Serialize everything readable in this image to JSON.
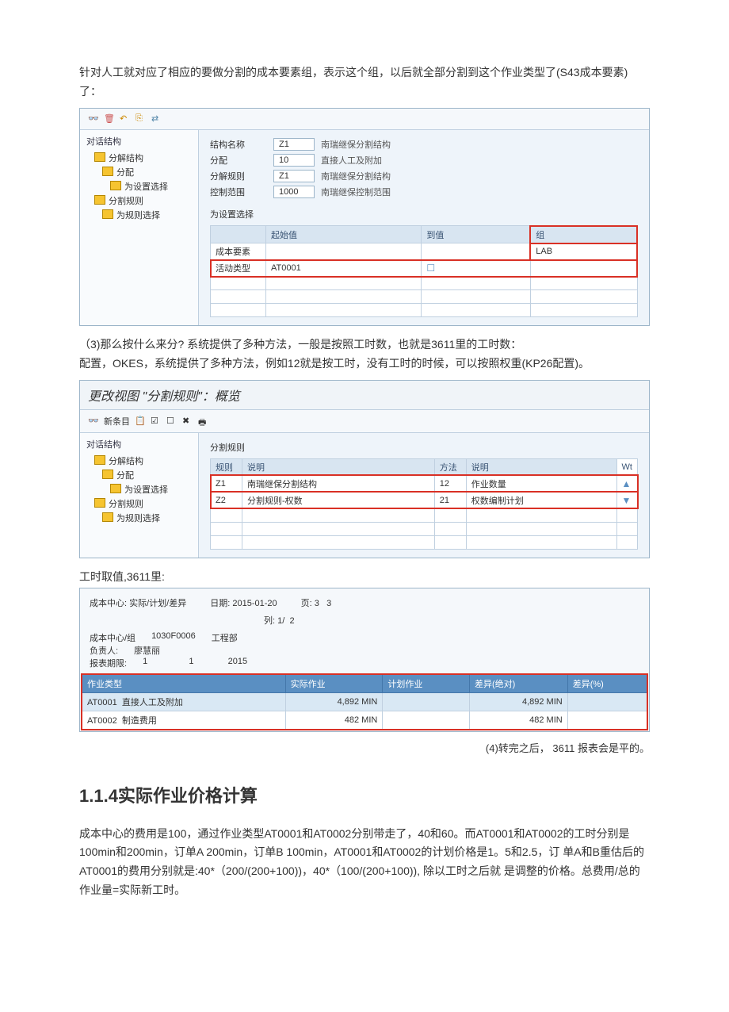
{
  "intro_para": "针对人工就对应了相应的要做分割的成本要素组，表示这个组，以后就全部分割到这个作业类型了(S43成本要素)了：",
  "sap1": {
    "tree_header": "对话结构",
    "tree_nodes": [
      "分解结构",
      "分配",
      "为设置选择",
      "分割规则",
      "为规则选择"
    ],
    "fields": [
      {
        "label": "结构名称",
        "val": "Z1",
        "desc": "南瑞继保分割结构"
      },
      {
        "label": "分配",
        "val": "10",
        "desc": "直接人工及附加"
      },
      {
        "label": "分解规则",
        "val": "Z1",
        "desc": "南瑞继保分割结构"
      },
      {
        "label": "控制范围",
        "val": "1000",
        "desc": "南瑞继保控制范围"
      }
    ],
    "subhead": "为设置选择",
    "grid_headers": [
      "",
      "起始值",
      "到值",
      "组"
    ],
    "cost_element_label": "成本要素",
    "activity_type_label": "活动类型",
    "activity_start": "AT0001",
    "group_val": "LAB"
  },
  "para3": "（3)那么按什么来分? 系统提供了多种方法，一般是按照工时数，也就是3611里的工时数：",
  "para3b": "配置，OKES，系统提供了多种方法，例如12就是按工时，没有工时的时候，可以按照权重(KP26配置)。",
  "sap2": {
    "title": "更改视图 \"分割规则\"：概览",
    "toolbar_label": "新条目",
    "tree_header": "对话结构",
    "tree_nodes": [
      "分解结构",
      "分配",
      "为设置选择",
      "分割规则",
      "为规则选择"
    ],
    "detail_header": "分割规则",
    "grid_headers": [
      "规则",
      "说明",
      "方法",
      "说明"
    ],
    "rows": [
      {
        "rule": "Z1",
        "desc": "南瑞继保分割结构",
        "method": "12",
        "method_desc": "作业数量"
      },
      {
        "rule": "Z2",
        "desc": "分割规则-权数",
        "method": "21",
        "method_desc": "权数编制计划"
      }
    ]
  },
  "para_gs": "工时取值,3611里:",
  "report": {
    "title": "成本中心: 实际/计划/差异",
    "date_label": "日期:",
    "date_val": "2015-01-20",
    "page_label": "页:",
    "page_val": "3",
    "page_total": "3",
    "col_label": "列:",
    "col_val": "1/",
    "col_total": "2",
    "lbl_center": "成本中心/组",
    "val_center": "1030F0006",
    "val_dept": "工程部",
    "lbl_owner": "负责人:",
    "val_owner": "廖慧丽",
    "lbl_period": "报表期限:",
    "val_period_a": "1",
    "val_period_b": "1",
    "val_period_c": "2015",
    "headers": [
      "作业类型",
      "实际作业",
      "计划作业",
      "差异(绝对)",
      "差异(%)"
    ],
    "rows": [
      {
        "type": "AT0001",
        "type_desc": "直接人工及附加",
        "actual": "4,892",
        "unit": "MIN",
        "plan": "",
        "var_abs": "4,892",
        "var_abs_unit": "MIN",
        "var_pct": ""
      },
      {
        "type": "AT0002",
        "type_desc": "制造费用",
        "actual": "482",
        "unit": "MIN",
        "plan": "",
        "var_abs": "482",
        "var_abs_unit": "MIN",
        "var_pct": ""
      }
    ]
  },
  "para4": "(4)转完之后，  3611 报表会是平的。",
  "section_heading": "1.1.4实际作业价格计算",
  "final_para": "成本中心的费用是100，通过作业类型AT0001和AT0002分别带走了，40和60。而AT0001和AT0002的工时分别是100min和200min，订单A 200min，订单B 100min，AT0001和AT0002的计划价格是1。5和2.5，订 单A和B重估后的AT0001的费用分别就是:40*（200/(200+100))，40*（100/(200+100)), 除以工时之后就 是调整的价格。总费用/总的作业量=实际新工时。"
}
